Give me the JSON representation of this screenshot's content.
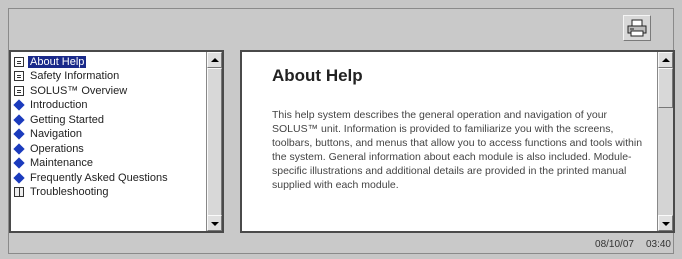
{
  "toolbar": {
    "print_icon": "printer-icon"
  },
  "toc": {
    "items": [
      {
        "label": "About Help",
        "icon": "page",
        "selected": true
      },
      {
        "label": "Safety Information",
        "icon": "page"
      },
      {
        "label": "SOLUS™ Overview",
        "icon": "page"
      },
      {
        "label": "Introduction",
        "icon": "book"
      },
      {
        "label": "Getting Started",
        "icon": "book"
      },
      {
        "label": "Navigation",
        "icon": "book"
      },
      {
        "label": "Operations",
        "icon": "book"
      },
      {
        "label": "Maintenance",
        "icon": "book"
      },
      {
        "label": "Frequently Asked Questions",
        "icon": "book"
      },
      {
        "label": "Troubleshooting",
        "icon": "book-open"
      }
    ]
  },
  "content": {
    "title": "About Help",
    "body": "This help system describes the general operation and navigation of your SOLUS™ unit. Information is provided to familiarize you with the screens, toolbars, buttons, and menus that allow you to access functions and tools within the system. General information about each module is also included. Module-specific illustrations and additional details are provided in the printed manual supplied with each module."
  },
  "status": {
    "date": "08/10/07",
    "time": "03:40"
  },
  "colors": {
    "selection": "#1a2a8a",
    "book_icon": "#1b3bbd"
  }
}
